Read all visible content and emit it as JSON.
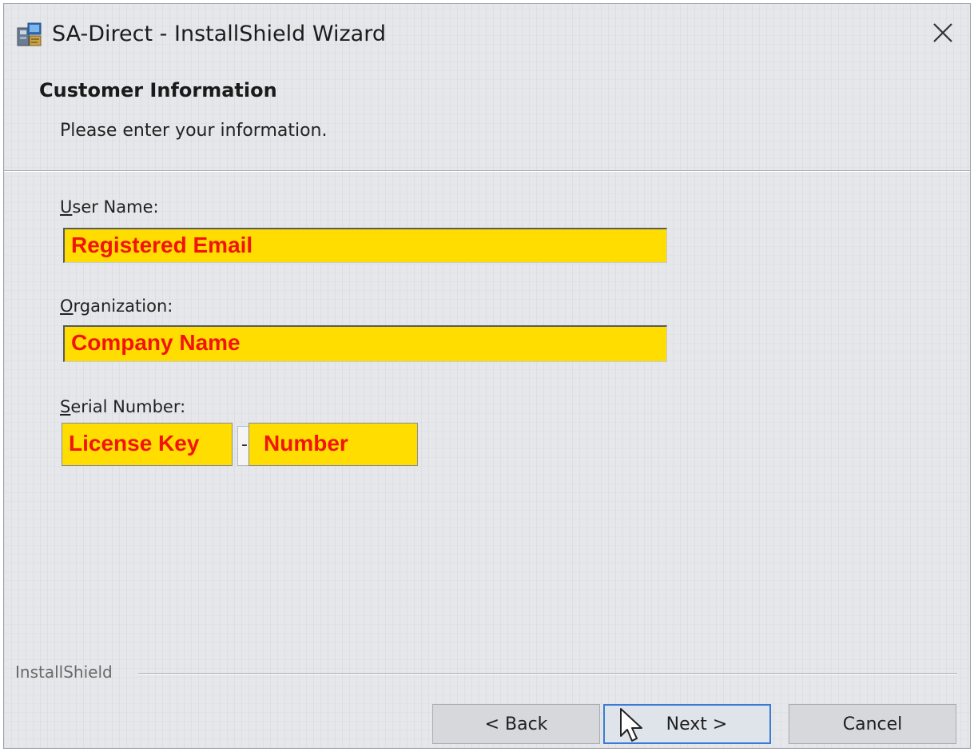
{
  "window": {
    "title": "SA-Direct - InstallShield Wizard",
    "icon": "installer-icon",
    "close_icon": "close-icon"
  },
  "header": {
    "title": "Customer Information",
    "subtitle": "Please enter your information."
  },
  "form": {
    "user_name": {
      "label_first": "U",
      "label_rest": "ser Name:",
      "value": "Registered Email"
    },
    "organization": {
      "label_first": "O",
      "label_rest": "rganization:",
      "value": "Company Name"
    },
    "serial_number": {
      "label_first": "S",
      "label_rest": "erial Number:",
      "part1": "License Key",
      "separator": "-",
      "part2": "Number"
    }
  },
  "footer": {
    "brand": "InstallShield",
    "buttons": {
      "back": "< Back",
      "next": "Next >",
      "cancel": "Cancel"
    }
  },
  "colors": {
    "highlight": "#ffdd00",
    "highlight_text": "#f2140a",
    "focus": "#3a7bd5"
  }
}
